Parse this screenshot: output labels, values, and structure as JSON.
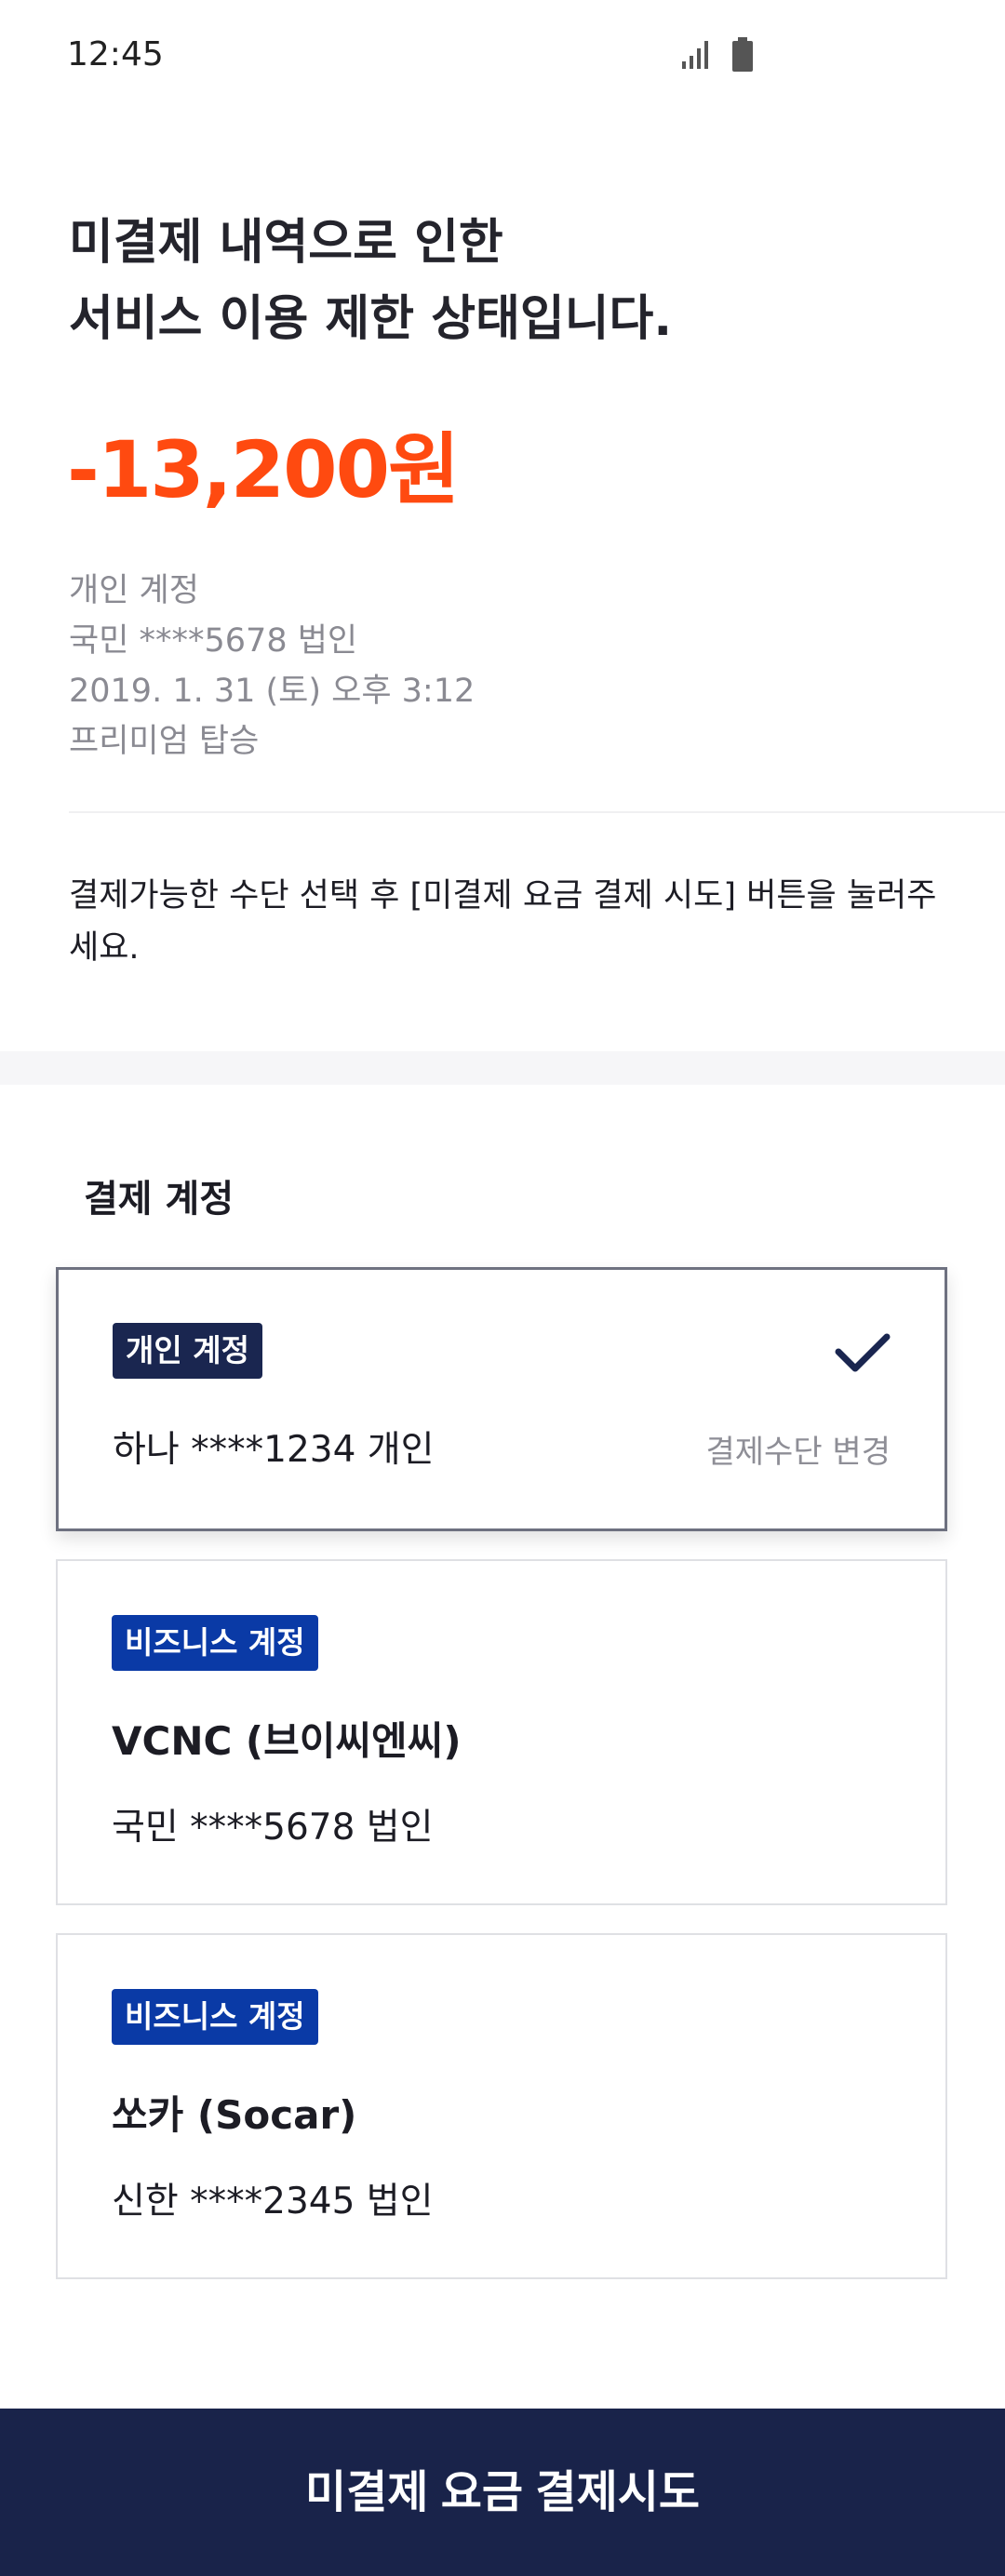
{
  "status_bar": {
    "time": "12:45",
    "signal_icon": "signal-icon",
    "battery_icon": "battery-icon"
  },
  "headline": {
    "line1": "미결제 내역으로 인한",
    "line2": "서비스 이용 제한 상태입니다."
  },
  "amount": "-13,200원",
  "ride_info": {
    "account_type": "개인 계정",
    "card": "국민 ****5678 법인",
    "datetime": "2019. 1. 31 (토) 오후 3:12",
    "service": "프리미엄 탑승"
  },
  "instruction": "결제가능한 수단 선택 후 [미결제 요금 결제 시도] 버튼을 눌러주세요.",
  "payment_section": {
    "title": "결제 계정",
    "accounts": [
      {
        "badge": "개인 계정",
        "name": "",
        "card": "하나 ****1234 개인",
        "selected": true,
        "change_label": "결제수단 변경"
      },
      {
        "badge": "비즈니스 계정",
        "name": "VCNC (브이씨엔씨)",
        "card": "국민 ****5678 법인",
        "selected": false
      },
      {
        "badge": "비즈니스 계정",
        "name": "쏘카 (Socar)",
        "card": "신한 ****2345 법인",
        "selected": false
      }
    ]
  },
  "pay_button_label": "미결제 요금 결제시도",
  "colors": {
    "amount": "#ff4a10",
    "personal_badge": "#1a2650",
    "business_badge": "#0a3aa6",
    "button_bg": "#19234a"
  },
  "icons": {
    "check": "check-icon"
  }
}
